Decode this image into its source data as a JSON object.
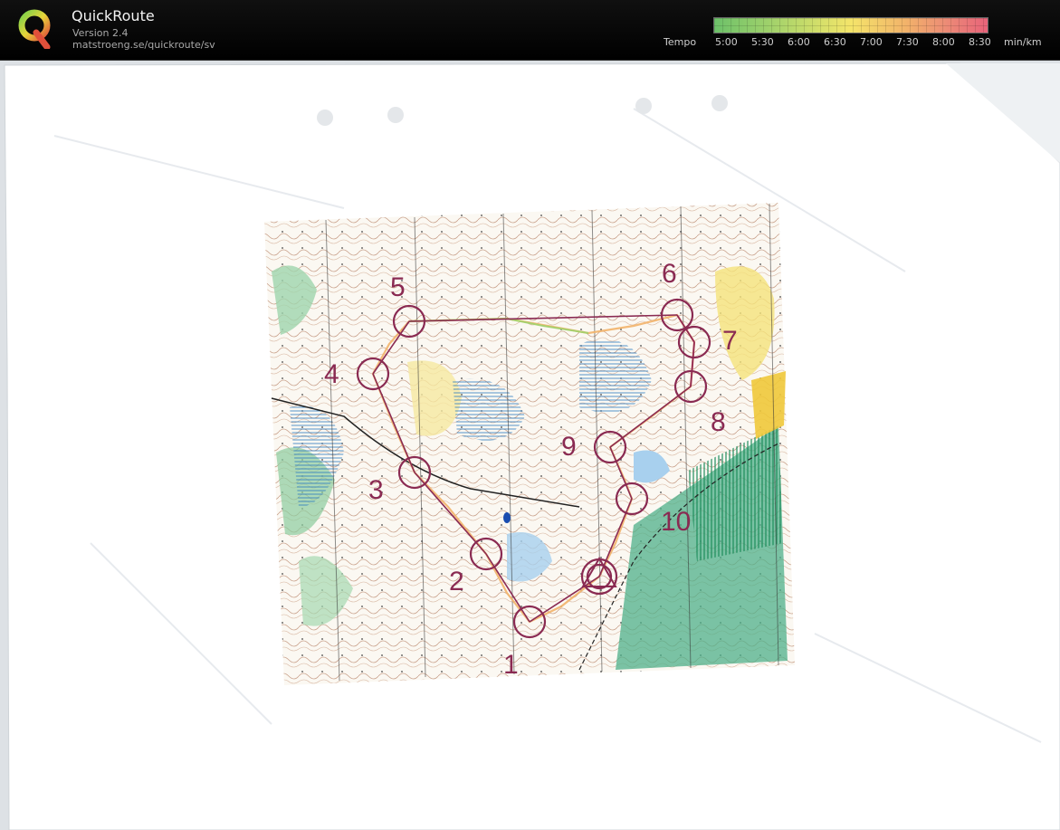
{
  "app": {
    "title": "QuickRoute",
    "version": "Version 2.4",
    "url": "matstroeng.se/quickroute/sv",
    "logo_letter": "Q"
  },
  "tempo_scale": {
    "label": "Tempo",
    "unit": "min/km",
    "ticks": [
      "5:00",
      "5:30",
      "6:00",
      "6:30",
      "7:00",
      "7:30",
      "8:00",
      "8:30"
    ],
    "colors": [
      "#6dc16a",
      "#d8e06a",
      "#f4e46a",
      "#f2b36a",
      "#e8637a"
    ]
  },
  "map": {
    "route_color": "#8a2a52",
    "controls": [
      {
        "label": "1"
      },
      {
        "label": "2"
      },
      {
        "label": "3"
      },
      {
        "label": "4"
      },
      {
        "label": "5"
      },
      {
        "label": "6"
      },
      {
        "label": "7"
      },
      {
        "label": "8"
      },
      {
        "label": "9"
      },
      {
        "label": "10"
      }
    ]
  }
}
